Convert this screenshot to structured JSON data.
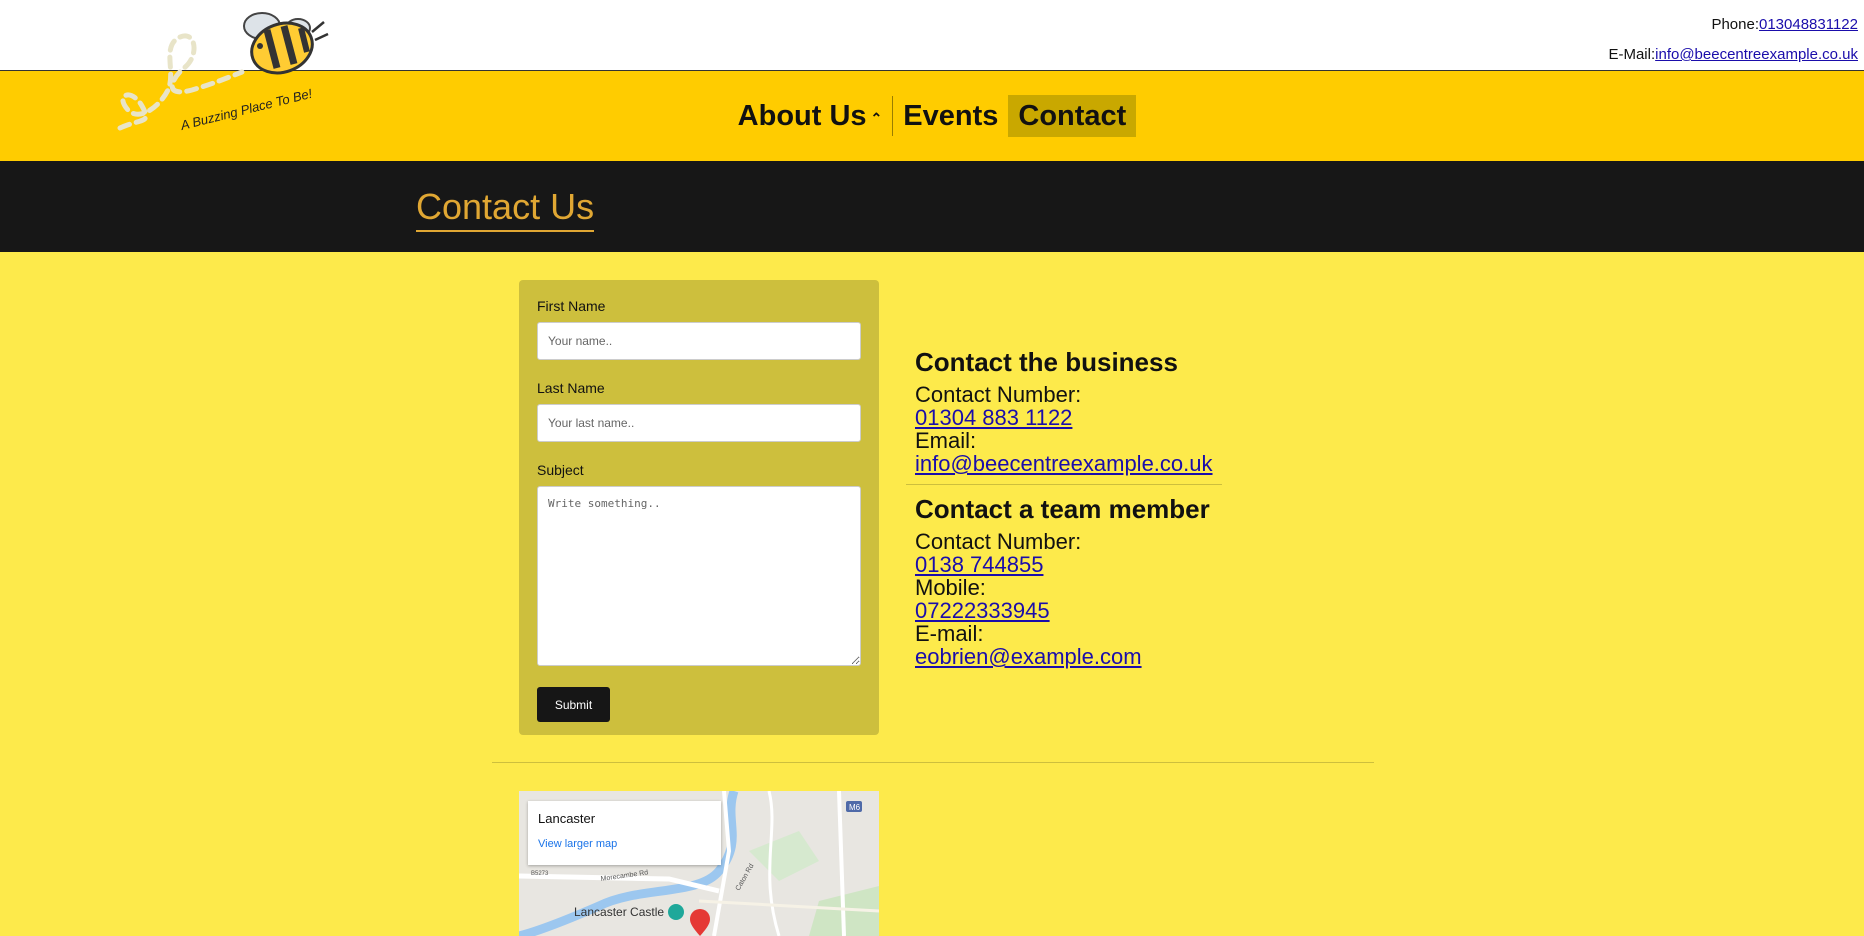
{
  "header": {
    "phone_label": "Phone:",
    "phone_value": "013048831122",
    "email_label": "E-Mail:",
    "email_value": "info@beecentreexample.co.uk"
  },
  "logo": {
    "tagline": "A Buzzing Place To Be!"
  },
  "nav": {
    "items": [
      {
        "label": "About Us",
        "has_dropdown": true,
        "caret": "⌃"
      },
      {
        "label": "Events"
      },
      {
        "label": "Contact",
        "active": true
      }
    ]
  },
  "page": {
    "title": "Contact Us"
  },
  "form": {
    "first_name_label": "First Name",
    "first_name_placeholder": "Your name..",
    "last_name_label": "Last Name",
    "last_name_placeholder": "Your last name..",
    "subject_label": "Subject",
    "subject_placeholder": "Write something..",
    "submit_label": "Submit"
  },
  "business": {
    "heading": "Contact the business",
    "number_label": "Contact Number:",
    "number_value": "01304 883 1122",
    "email_label": "Email:",
    "email_value": "info@beecentreexample.co.uk"
  },
  "team": {
    "heading": "Contact a team member",
    "number_label": "Contact Number:",
    "number_value": "0138 744855",
    "mobile_label": "Mobile:",
    "mobile_value": "07222333945",
    "email_label": "E-mail:",
    "email_value": "eobrien@example.com"
  },
  "map": {
    "place": "Lancaster",
    "larger_map_link": "View larger map",
    "landmark": "Lancaster Castle",
    "road_label_1": "Morecambe Rd",
    "road_label_2": "Caton Rd",
    "motorway_badge": "M6",
    "road_label_3": "B5273"
  },
  "colors": {
    "page_bg": "#fdea4b",
    "nav_bg": "#ffcc00",
    "title_band_bg": "#171717",
    "title_color": "#e0a733",
    "form_panel_bg": "#cdbf3d",
    "link_color": "#1a0dab"
  }
}
